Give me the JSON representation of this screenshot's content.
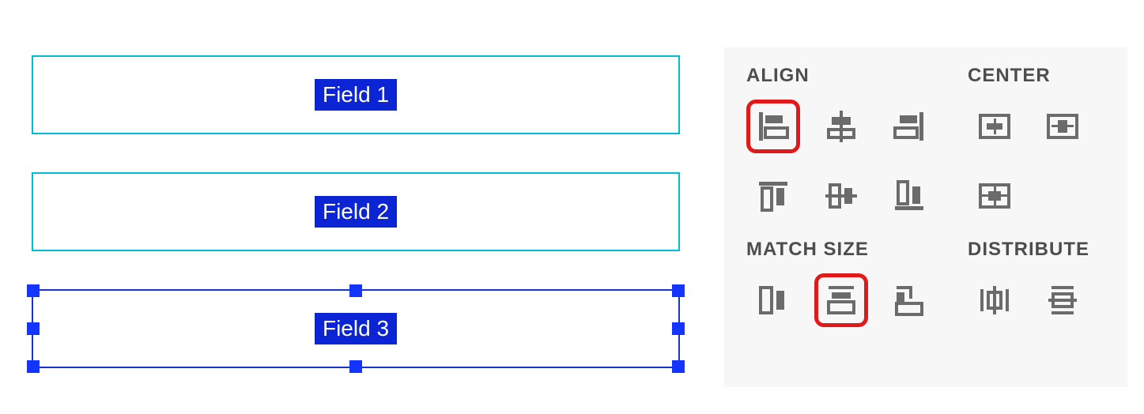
{
  "fields": [
    {
      "label": "Field 1"
    },
    {
      "label": "Field 2"
    },
    {
      "label": "Field 3"
    }
  ],
  "panel": {
    "align_title": "ALIGN",
    "center_title": "CENTER",
    "match_title": "MATCH SIZE",
    "distribute_title": "DISTRIBUTE"
  }
}
